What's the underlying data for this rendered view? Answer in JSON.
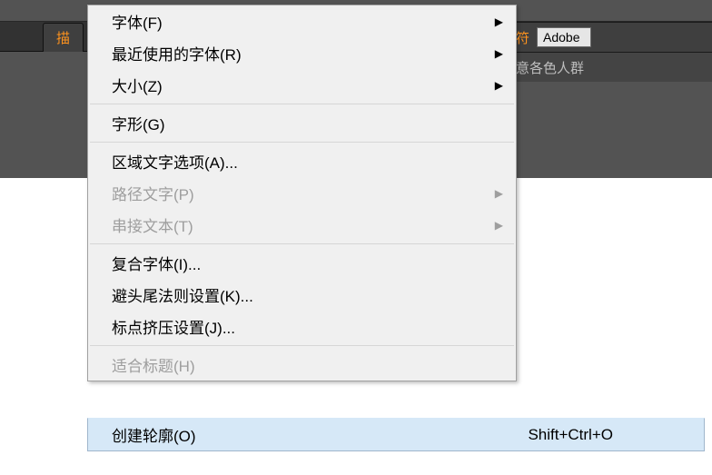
{
  "background": {
    "tab_label": "描",
    "char_label": "字符",
    "font_dropdown_value": "Adobe",
    "hint_text": "创意各色人群"
  },
  "menu": {
    "items": [
      {
        "label": "字体(F)",
        "shortcut": "",
        "arrow": true,
        "disabled": false
      },
      {
        "label": "最近使用的字体(R)",
        "shortcut": "",
        "arrow": true,
        "disabled": false
      },
      {
        "label": "大小(Z)",
        "shortcut": "",
        "arrow": true,
        "disabled": false
      },
      {
        "sep": true
      },
      {
        "label": "字形(G)",
        "shortcut": "",
        "arrow": false,
        "disabled": false
      },
      {
        "sep": true
      },
      {
        "label": "区域文字选项(A)...",
        "shortcut": "",
        "arrow": false,
        "disabled": false
      },
      {
        "label": "路径文字(P)",
        "shortcut": "",
        "arrow": true,
        "disabled": true
      },
      {
        "label": "串接文本(T)",
        "shortcut": "",
        "arrow": true,
        "disabled": true
      },
      {
        "sep": true
      },
      {
        "label": "复合字体(I)...",
        "shortcut": "",
        "arrow": false,
        "disabled": false
      },
      {
        "label": "避头尾法则设置(K)...",
        "shortcut": "",
        "arrow": false,
        "disabled": false
      },
      {
        "label": "标点挤压设置(J)...",
        "shortcut": "",
        "arrow": false,
        "disabled": false
      },
      {
        "sep": true
      },
      {
        "label": "适合标题(H)",
        "shortcut": "",
        "arrow": false,
        "disabled": true
      }
    ],
    "highlighted": {
      "label": "创建轮廓(O)",
      "shortcut": "Shift+Ctrl+O"
    }
  }
}
